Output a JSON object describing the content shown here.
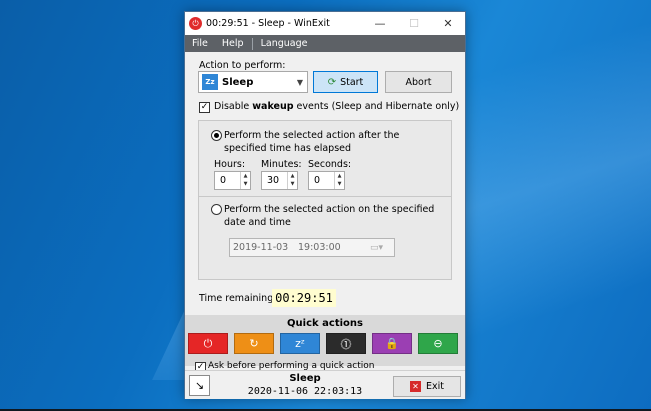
{
  "window": {
    "title": "00:29:51 - Sleep - WinExit",
    "buttons": {
      "minimize": "—",
      "maximize": "☐",
      "close": "✕"
    }
  },
  "menu": {
    "file": "File",
    "help": "Help",
    "language": "Language"
  },
  "action": {
    "label": "Action to perform:",
    "selected": "Sleep",
    "start_label": "Start",
    "abort_label": "Abort"
  },
  "disable_wakeup": {
    "checked": true,
    "pre": "Disable ",
    "bold": "wakeup",
    "post": " events (Sleep and Hibernate only)"
  },
  "mode_elapsed": {
    "selected": true,
    "text": "Perform the selected action after the specified time has elapsed",
    "hours_label": "Hours:",
    "minutes_label": "Minutes:",
    "seconds_label": "Seconds:",
    "hours": "0",
    "minutes": "30",
    "seconds": "0"
  },
  "mode_datetime": {
    "selected": false,
    "text": "Perform the selected action on the specified date and time",
    "date": "2019-11-03",
    "time": "19:03:00"
  },
  "remaining": {
    "label": "Time remaining:",
    "value": "00:29:51"
  },
  "quick_actions": {
    "title": "Quick actions",
    "buttons": [
      {
        "name": "shutdown",
        "color": "#e52626",
        "icon": "power-icon",
        "glyph": "⏻"
      },
      {
        "name": "restart",
        "color": "#ee8f16",
        "icon": "restart-icon",
        "glyph": "↻"
      },
      {
        "name": "sleep",
        "color": "#2f86d6",
        "icon": "sleep-icon",
        "glyph": "zᶻ"
      },
      {
        "name": "hibernate",
        "color": "#2b2b2b",
        "icon": "hibernate-icon",
        "glyph": "⓵"
      },
      {
        "name": "lock",
        "color": "#9b3fb3",
        "icon": "lock-icon",
        "glyph": "🔒"
      },
      {
        "name": "logoff",
        "color": "#2fa64a",
        "icon": "logoff-icon",
        "glyph": "⊖"
      }
    ],
    "ask_checked": true,
    "ask_label": "Ask before performing a quick action"
  },
  "footer": {
    "action": "Sleep",
    "datetime": "2020-11-06 22:03:13",
    "exit_label": "Exit"
  }
}
